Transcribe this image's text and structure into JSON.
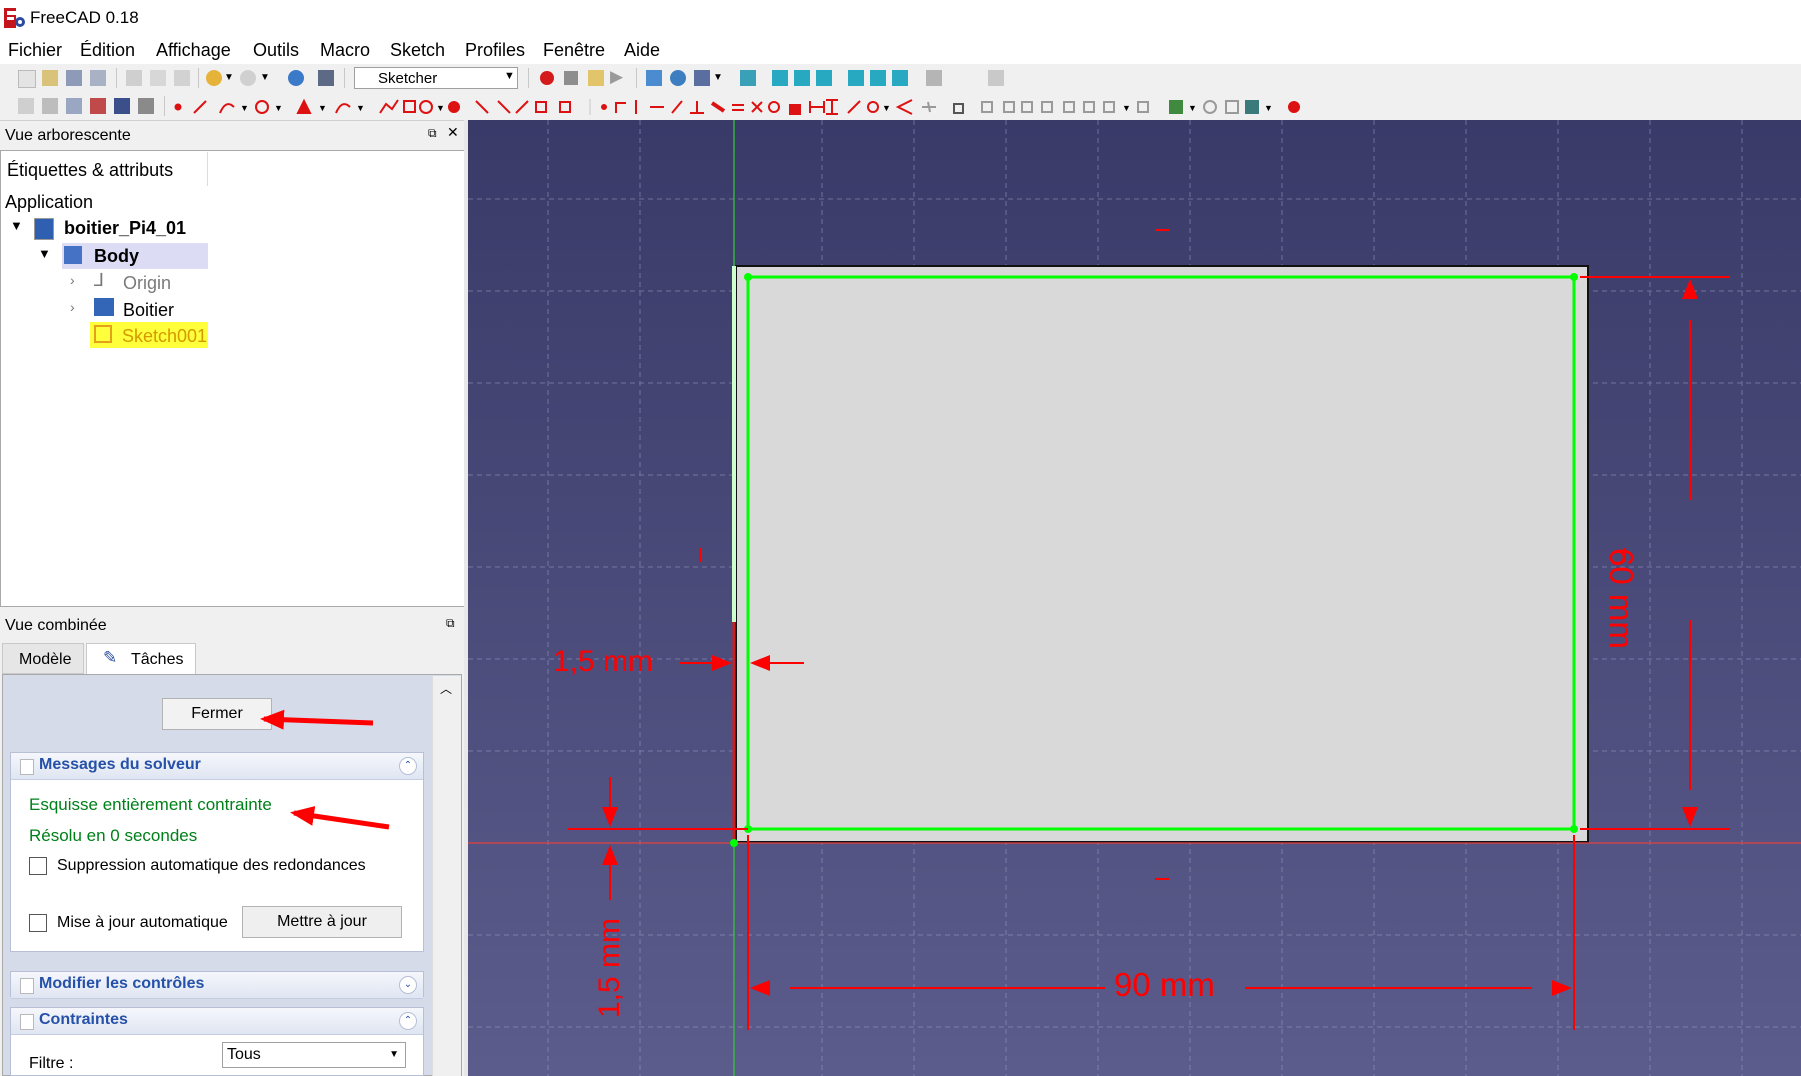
{
  "window": {
    "title": "FreeCAD 0.18"
  },
  "menubar": {
    "items": [
      "Fichier",
      "Édition",
      "Affichage",
      "Outils",
      "Macro",
      "Sketch",
      "Profiles",
      "Fenêtre",
      "Aide"
    ]
  },
  "toolbar": {
    "workbench": "Sketcher"
  },
  "tree_view": {
    "title": "Vue arborescente",
    "header": "Étiquettes & attributs",
    "root_label": "Application",
    "document": "boitier_Pi4_01",
    "body": "Body",
    "origin": "Origin",
    "feature": "Boitier",
    "sketch": "Sketch001"
  },
  "combo_view": {
    "title": "Vue combinée",
    "tabs": [
      "Modèle",
      "Tâches"
    ],
    "active_tab": "Tâches",
    "close_button": "Fermer",
    "solver": {
      "title": "Messages du solveur",
      "status": "Esquisse entièrement contrainte",
      "solved": "Résolu en 0 secondes",
      "auto_remove_redundants": "Suppression automatique des redondances",
      "auto_update": "Mise à jour automatique",
      "update_button": "Mettre à jour"
    },
    "edit_controls": {
      "title": "Modifier les contrôles"
    },
    "constraints": {
      "title": "Contraintes",
      "filter_label": "Filtre :",
      "filter_value": "Tous"
    }
  },
  "sketch": {
    "dimensions": {
      "offset_x": "1,5 mm",
      "offset_y": "1,5 mm",
      "width": "90 mm",
      "height": "60 mm"
    }
  },
  "colors": {
    "viewport_top": "#3a3a69",
    "viewport_bottom": "#5c5c8c",
    "sketch_line": "#00ff00",
    "constraint": "#ff0000",
    "annotation_arrow": "#ff0000",
    "face": "#d9d9d9"
  }
}
